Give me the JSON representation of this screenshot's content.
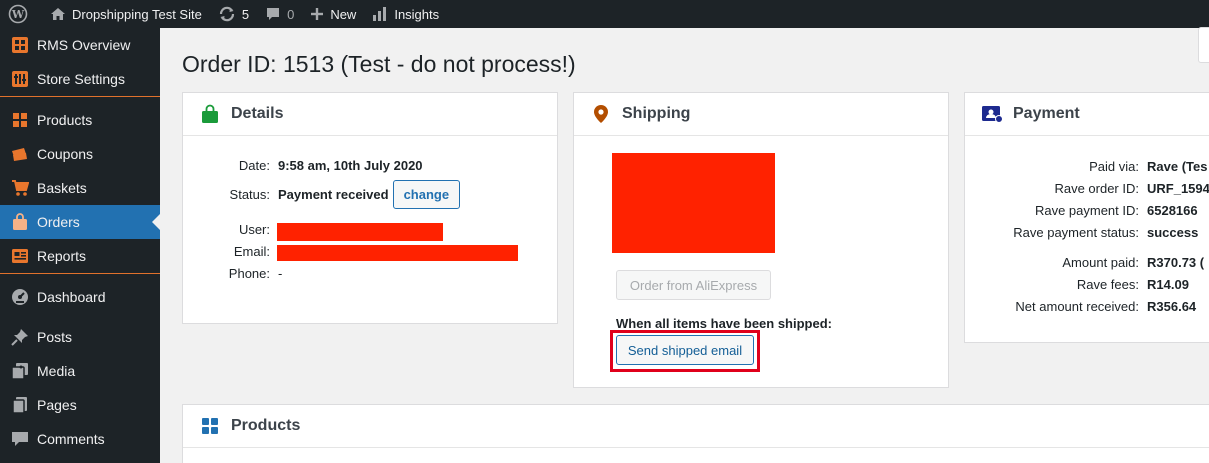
{
  "admin_bar": {
    "site_name": "Dropshipping Test Site",
    "updates_count": "5",
    "comments_count": "0",
    "new_label": "New",
    "insights_label": "Insights"
  },
  "sidebar": {
    "items": [
      {
        "label": "RMS Overview",
        "icon": "rms-overview-icon"
      },
      {
        "label": "Store Settings",
        "icon": "store-settings-icon"
      },
      {
        "label": "Products",
        "icon": "products-grid-icon"
      },
      {
        "label": "Coupons",
        "icon": "coupons-icon"
      },
      {
        "label": "Baskets",
        "icon": "cart-icon"
      },
      {
        "label": "Orders",
        "icon": "shopping-bag-icon"
      },
      {
        "label": "Reports",
        "icon": "reports-icon"
      },
      {
        "label": "Dashboard",
        "icon": "dashboard-gauge-icon"
      },
      {
        "label": "Posts",
        "icon": "pushpin-icon"
      },
      {
        "label": "Media",
        "icon": "media-icon"
      },
      {
        "label": "Pages",
        "icon": "pages-icon"
      },
      {
        "label": "Comments",
        "icon": "comment-bubble-icon"
      }
    ],
    "active": "Orders"
  },
  "page": {
    "title": "Order ID: 1513 (Test - do not process!)"
  },
  "details": {
    "title": "Details",
    "date_label": "Date:",
    "date_value": "9:58 am, 10th July 2020",
    "status_label": "Status:",
    "status_value": "Payment received",
    "change_button": "change",
    "user_label": "User:",
    "email_label": "Email:",
    "phone_label": "Phone:",
    "phone_value": "-"
  },
  "shipping": {
    "title": "Shipping",
    "aliexpress_button": "Order from AliExpress",
    "shipped_prompt": "When all items have been shipped:",
    "send_email_button": "Send shipped email"
  },
  "payment": {
    "title": "Payment",
    "rows": [
      {
        "label": "Paid via:",
        "value": "Rave (Tes"
      },
      {
        "label": "Rave order ID:",
        "value": "URF_1594"
      },
      {
        "label": "Rave payment ID:",
        "value": "6528166"
      },
      {
        "label": "Rave payment status:",
        "value": "success"
      },
      {
        "label": "Amount paid:",
        "value": "R370.73 ("
      },
      {
        "label": "Rave fees:",
        "value": "R14.09"
      },
      {
        "label": "Net amount received:",
        "value": "R356.64"
      }
    ]
  },
  "products": {
    "title": "Products"
  },
  "colors": {
    "admin_bg": "#1d2327",
    "accent_blue": "#2271b1",
    "menu_icon_orange": "#e8762d",
    "redaction_red": "#ff2200",
    "highlight_red": "#e0001b"
  }
}
